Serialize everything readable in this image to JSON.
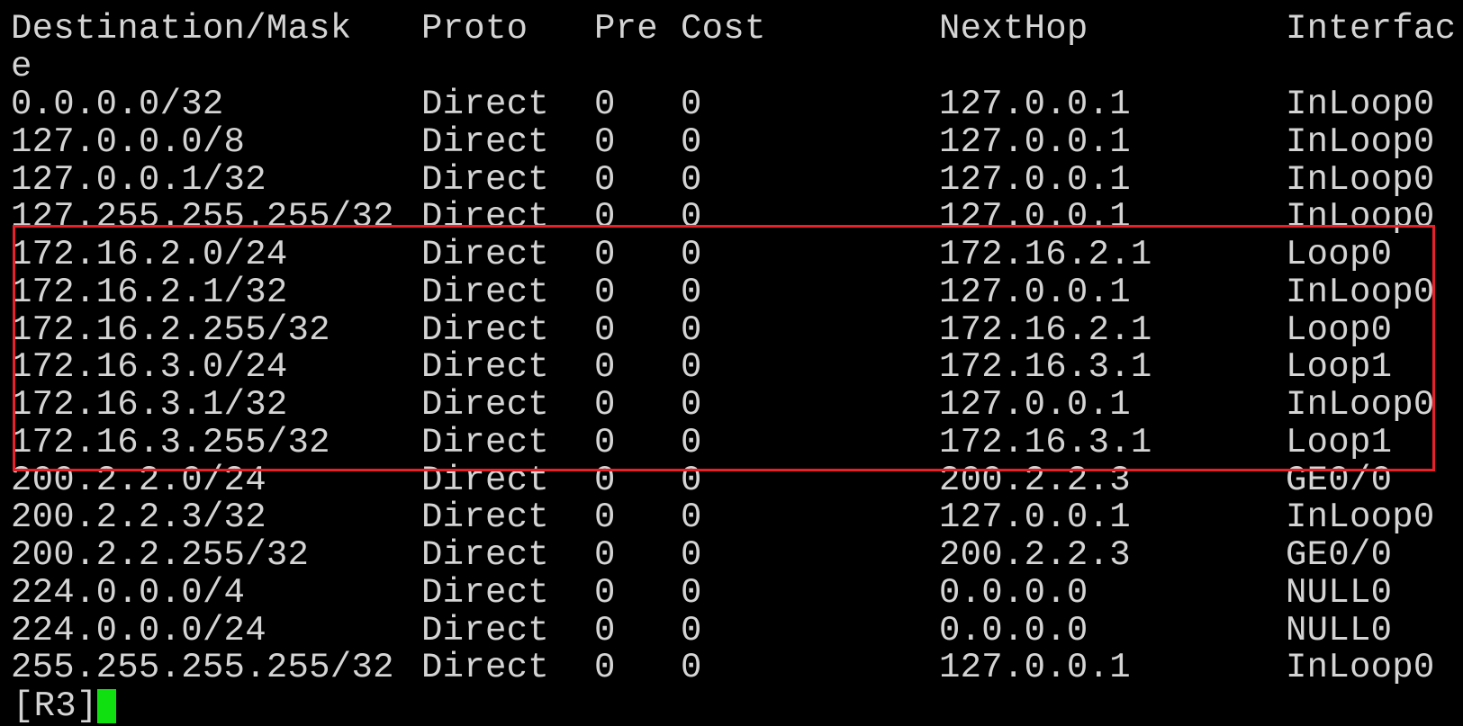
{
  "header": {
    "destination": "Destination/Mask",
    "proto": "Proto",
    "pre": "Pre",
    "cost": "Cost",
    "nexthop": "NextHop",
    "interface": "Interfac",
    "interface_wrap": "e"
  },
  "routes": [
    {
      "dest": "0.0.0.0/32",
      "proto": "Direct",
      "pre": "0",
      "cost": "0",
      "nexthop": "127.0.0.1",
      "iface": "InLoop0"
    },
    {
      "dest": "127.0.0.0/8",
      "proto": "Direct",
      "pre": "0",
      "cost": "0",
      "nexthop": "127.0.0.1",
      "iface": "InLoop0"
    },
    {
      "dest": "127.0.0.1/32",
      "proto": "Direct",
      "pre": "0",
      "cost": "0",
      "nexthop": "127.0.0.1",
      "iface": "InLoop0"
    },
    {
      "dest": "127.255.255.255/32",
      "proto": "Direct",
      "pre": "0",
      "cost": "0",
      "nexthop": "127.0.0.1",
      "iface": "InLoop0"
    },
    {
      "dest": "172.16.2.0/24",
      "proto": "Direct",
      "pre": "0",
      "cost": "0",
      "nexthop": "172.16.2.1",
      "iface": "Loop0"
    },
    {
      "dest": "172.16.2.1/32",
      "proto": "Direct",
      "pre": "0",
      "cost": "0",
      "nexthop": "127.0.0.1",
      "iface": "InLoop0"
    },
    {
      "dest": "172.16.2.255/32",
      "proto": "Direct",
      "pre": "0",
      "cost": "0",
      "nexthop": "172.16.2.1",
      "iface": "Loop0"
    },
    {
      "dest": "172.16.3.0/24",
      "proto": "Direct",
      "pre": "0",
      "cost": "0",
      "nexthop": "172.16.3.1",
      "iface": "Loop1"
    },
    {
      "dest": "172.16.3.1/32",
      "proto": "Direct",
      "pre": "0",
      "cost": "0",
      "nexthop": "127.0.0.1",
      "iface": "InLoop0"
    },
    {
      "dest": "172.16.3.255/32",
      "proto": "Direct",
      "pre": "0",
      "cost": "0",
      "nexthop": "172.16.3.1",
      "iface": "Loop1"
    },
    {
      "dest": "200.2.2.0/24",
      "proto": "Direct",
      "pre": "0",
      "cost": "0",
      "nexthop": "200.2.2.3",
      "iface": "GE0/0"
    },
    {
      "dest": "200.2.2.3/32",
      "proto": "Direct",
      "pre": "0",
      "cost": "0",
      "nexthop": "127.0.0.1",
      "iface": "InLoop0"
    },
    {
      "dest": "200.2.2.255/32",
      "proto": "Direct",
      "pre": "0",
      "cost": "0",
      "nexthop": "200.2.2.3",
      "iface": "GE0/0"
    },
    {
      "dest": "224.0.0.0/4",
      "proto": "Direct",
      "pre": "0",
      "cost": "0",
      "nexthop": "0.0.0.0",
      "iface": "NULL0"
    },
    {
      "dest": "224.0.0.0/24",
      "proto": "Direct",
      "pre": "0",
      "cost": "0",
      "nexthop": "0.0.0.0",
      "iface": "NULL0"
    },
    {
      "dest": "255.255.255.255/32",
      "proto": "Direct",
      "pre": "0",
      "cost": "0",
      "nexthop": "127.0.0.1",
      "iface": "InLoop0"
    }
  ],
  "prompt": "[R3]",
  "colors": {
    "background": "#000000",
    "text": "#d4d4d4",
    "highlight": "#e8202a",
    "cursor": "#10e010"
  }
}
